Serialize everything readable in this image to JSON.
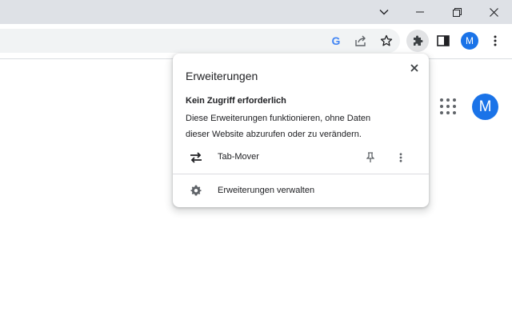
{
  "window": {
    "controls": [
      "chevron-down",
      "minimize",
      "restore",
      "close"
    ]
  },
  "toolbar": {
    "profile_initial": "M",
    "google_letter": "G"
  },
  "page": {
    "profile_initial": "M"
  },
  "extensions_popup": {
    "title": "Erweiterungen",
    "section_heading": "Kein Zugriff erforderlich",
    "section_description": "Diese Erweiterungen funktionieren, ohne Daten dieser Website abzurufen oder zu verändern.",
    "extensions": [
      {
        "name": "Tab-Mover",
        "icon": "swap-arrows-icon"
      }
    ],
    "manage_label": "Erweiterungen verwalten"
  },
  "colors": {
    "titlebar": "#dee1e6",
    "accent": "#1a73e8",
    "icon": "#5f6368"
  }
}
